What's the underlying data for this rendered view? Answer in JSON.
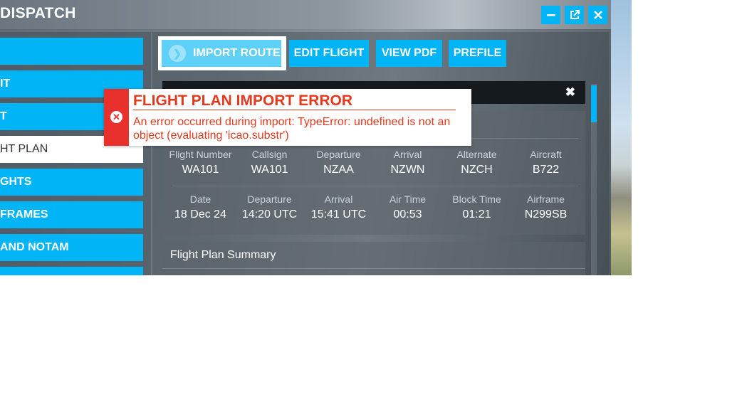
{
  "window": {
    "title": "DISPATCH",
    "controls": {
      "minimize_icon": "minimize-icon",
      "popout_icon": "popout-icon",
      "close_icon": "close-icon"
    }
  },
  "sidebar": {
    "items": [
      {
        "label": ""
      },
      {
        "label": "IT"
      },
      {
        "label": "T"
      },
      {
        "label": "HT PLAN",
        "active": true
      },
      {
        "label": "GHTS"
      },
      {
        "label": "FRAMES"
      },
      {
        "label": "AND NOTAM"
      }
    ]
  },
  "toolbar": {
    "import_label": "IMPORT ROUTE",
    "edit_label": "EDIT FLIGHT",
    "pdf_label": "VIEW PDF",
    "prefile_label": "PREFILE"
  },
  "flight_info": {
    "row1": [
      {
        "label": "Flight Number",
        "value": "WA101"
      },
      {
        "label": "Callsign",
        "value": "WA101"
      },
      {
        "label": "Departure",
        "value": "NZAA"
      },
      {
        "label": "Arrival",
        "value": "NZWN"
      },
      {
        "label": "Alternate",
        "value": "NZCH"
      },
      {
        "label": "Aircraft",
        "value": "B722"
      }
    ],
    "row2": [
      {
        "label": "Date",
        "value": "18 Dec 24"
      },
      {
        "label": "Departure",
        "value": "14:20 UTC"
      },
      {
        "label": "Arrival",
        "value": "15:41 UTC"
      },
      {
        "label": "Air Time",
        "value": "00:53"
      },
      {
        "label": "Block Time",
        "value": "01:21"
      },
      {
        "label": "Airframe",
        "value": "N299SB"
      }
    ]
  },
  "summary": {
    "title": "Flight Plan Summary"
  },
  "error": {
    "title": "FLIGHT PLAN IMPORT ERROR",
    "message": "An error occurred during import: TypeError: undefined is not an object (evaluating 'icao.substr')"
  },
  "colors": {
    "accent": "#00b4f5",
    "error": "#e23a1e",
    "error_side": "#e8312c"
  }
}
